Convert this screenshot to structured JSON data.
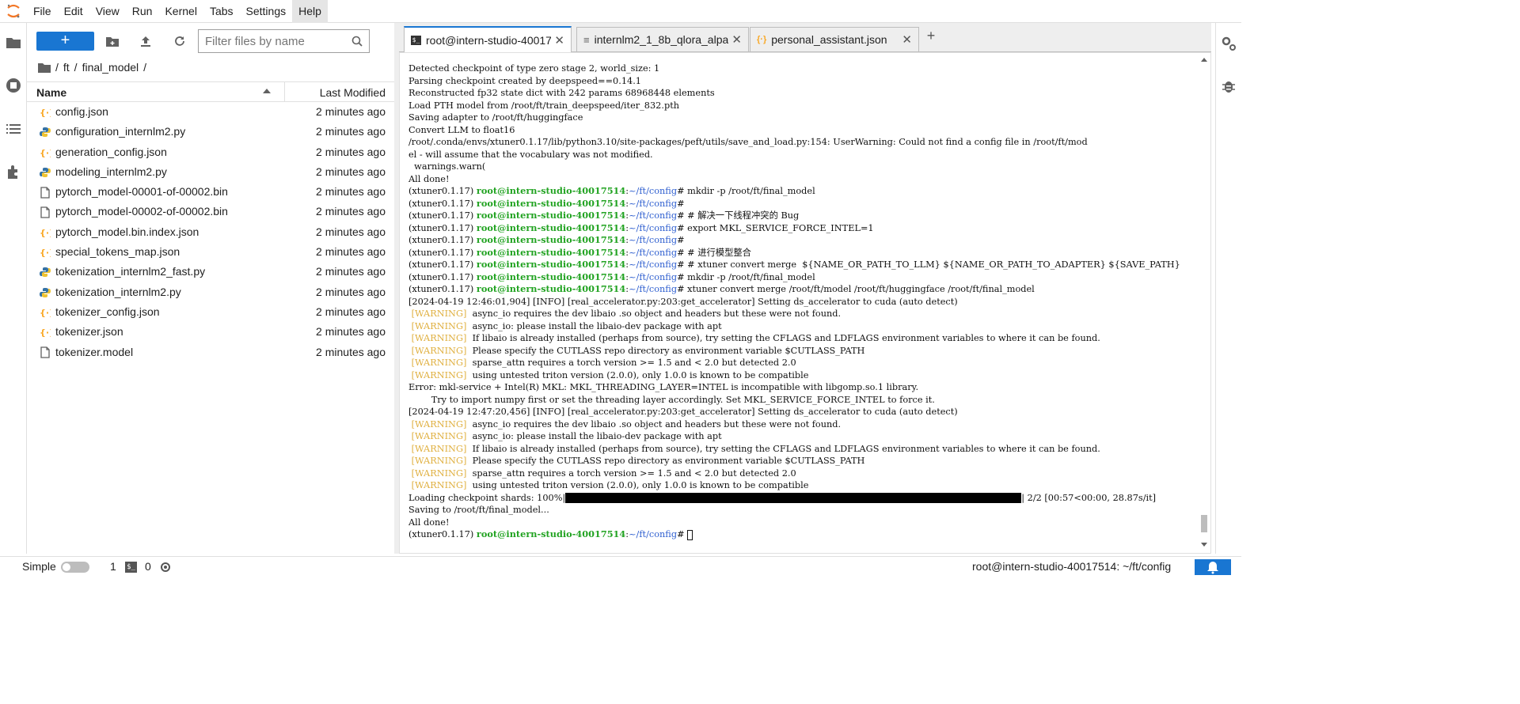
{
  "menu": [
    "File",
    "Edit",
    "View",
    "Run",
    "Kernel",
    "Tabs",
    "Settings",
    "Help"
  ],
  "file_browser": {
    "new_label": "+",
    "filter_placeholder": "Filter files by name",
    "breadcrumb": [
      "/",
      "ft",
      "/",
      "final_model",
      "/"
    ],
    "columns": {
      "name": "Name",
      "modified": "Last Modified"
    },
    "files": [
      {
        "name": "config.json",
        "type": "json",
        "modified": "2 minutes ago"
      },
      {
        "name": "configuration_internlm2.py",
        "type": "py",
        "modified": "2 minutes ago"
      },
      {
        "name": "generation_config.json",
        "type": "json",
        "modified": "2 minutes ago"
      },
      {
        "name": "modeling_internlm2.py",
        "type": "py",
        "modified": "2 minutes ago"
      },
      {
        "name": "pytorch_model-00001-of-00002.bin",
        "type": "file",
        "modified": "2 minutes ago"
      },
      {
        "name": "pytorch_model-00002-of-00002.bin",
        "type": "file",
        "modified": "2 minutes ago"
      },
      {
        "name": "pytorch_model.bin.index.json",
        "type": "json",
        "modified": "2 minutes ago"
      },
      {
        "name": "special_tokens_map.json",
        "type": "json",
        "modified": "2 minutes ago"
      },
      {
        "name": "tokenization_internlm2_fast.py",
        "type": "py",
        "modified": "2 minutes ago"
      },
      {
        "name": "tokenization_internlm2.py",
        "type": "py",
        "modified": "2 minutes ago"
      },
      {
        "name": "tokenizer_config.json",
        "type": "json",
        "modified": "2 minutes ago"
      },
      {
        "name": "tokenizer.json",
        "type": "json",
        "modified": "2 minutes ago"
      },
      {
        "name": "tokenizer.model",
        "type": "file",
        "modified": "2 minutes ago"
      }
    ]
  },
  "tabs": [
    {
      "label": "root@intern-studio-40017",
      "icon": "terminal-icon"
    },
    {
      "label": "internlm2_1_8b_qlora_alpa",
      "icon": "text-file-icon"
    },
    {
      "label": "personal_assistant.json",
      "icon": "json-icon"
    }
  ],
  "terminal": {
    "prompt_env": "(xtuner0.1.17) ",
    "prompt_host": "root@intern-studio-40017514",
    "prompt_path": "~/ft/config",
    "lines": [
      {
        "t": "plain",
        "text": "Detected checkpoint of type zero stage 2, world_size: 1"
      },
      {
        "t": "plain",
        "text": "Parsing checkpoint created by deepspeed==0.14.1"
      },
      {
        "t": "plain",
        "text": "Reconstructed fp32 state dict with 242 params 68968448 elements"
      },
      {
        "t": "plain",
        "text": "Load PTH model from /root/ft/train_deepspeed/iter_832.pth"
      },
      {
        "t": "plain",
        "text": "Saving adapter to /root/ft/huggingface"
      },
      {
        "t": "plain",
        "text": "Convert LLM to float16"
      },
      {
        "t": "plain",
        "text": "/root/.conda/envs/xtuner0.1.17/lib/python3.10/site-packages/peft/utils/save_and_load.py:154: UserWarning: Could not find a config file in /root/ft/mod"
      },
      {
        "t": "plain",
        "text": "el - will assume that the vocabulary was not modified."
      },
      {
        "t": "plain",
        "text": "  warnings.warn("
      },
      {
        "t": "plain",
        "text": "All done!"
      },
      {
        "t": "prompt",
        "text": "mkdir -p /root/ft/final_model"
      },
      {
        "t": "prompt",
        "text": ""
      },
      {
        "t": "prompt",
        "text": "# 解决一下线程冲突的 Bug"
      },
      {
        "t": "prompt",
        "text": "export MKL_SERVICE_FORCE_INTEL=1"
      },
      {
        "t": "prompt",
        "text": ""
      },
      {
        "t": "prompt",
        "text": "# 进行模型整合"
      },
      {
        "t": "prompt",
        "text": "# xtuner convert merge  ${NAME_OR_PATH_TO_LLM} ${NAME_OR_PATH_TO_ADAPTER} ${SAVE_PATH}"
      },
      {
        "t": "prompt",
        "text": "mkdir -p /root/ft/final_model"
      },
      {
        "t": "prompt",
        "text": "xtuner convert merge /root/ft/model /root/ft/huggingface /root/ft/final_model"
      },
      {
        "t": "plain",
        "text": "[2024-04-19 12:46:01,904] [INFO] [real_accelerator.py:203:get_accelerator] Setting ds_accelerator to cuda (auto detect)"
      },
      {
        "t": "warn",
        "text": "async_io requires the dev libaio .so object and headers but these were not found."
      },
      {
        "t": "warn",
        "text": "async_io: please install the libaio-dev package with apt"
      },
      {
        "t": "warn",
        "text": "If libaio is already installed (perhaps from source), try setting the CFLAGS and LDFLAGS environment variables to where it can be found."
      },
      {
        "t": "warn",
        "text": "Please specify the CUTLASS repo directory as environment variable $CUTLASS_PATH"
      },
      {
        "t": "warn",
        "text": "sparse_attn requires a torch version >= 1.5 and < 2.0 but detected 2.0"
      },
      {
        "t": "warn",
        "text": "using untested triton version (2.0.0), only 1.0.0 is known to be compatible"
      },
      {
        "t": "plain",
        "text": "Error: mkl-service + Intel(R) MKL: MKL_THREADING_LAYER=INTEL is incompatible with libgomp.so.1 library."
      },
      {
        "t": "plain",
        "text": "        Try to import numpy first or set the threading layer accordingly. Set MKL_SERVICE_FORCE_INTEL to force it."
      },
      {
        "t": "plain",
        "text": "[2024-04-19 12:47:20,456] [INFO] [real_accelerator.py:203:get_accelerator] Setting ds_accelerator to cuda (auto detect)"
      },
      {
        "t": "warn",
        "text": "async_io requires the dev libaio .so object and headers but these were not found."
      },
      {
        "t": "warn",
        "text": "async_io: please install the libaio-dev package with apt"
      },
      {
        "t": "warn",
        "text": "If libaio is already installed (perhaps from source), try setting the CFLAGS and LDFLAGS environment variables to where it can be found."
      },
      {
        "t": "warn",
        "text": "Please specify the CUTLASS repo directory as environment variable $CUTLASS_PATH"
      },
      {
        "t": "warn",
        "text": "sparse_attn requires a torch version >= 1.5 and < 2.0 but detected 2.0"
      },
      {
        "t": "warn",
        "text": "using untested triton version (2.0.0), only 1.0.0 is known to be compatible"
      },
      {
        "t": "progress",
        "pre": "Loading checkpoint shards: 100%|",
        "post": "| 2/2 [00:57<00:00, 28.87s/it]"
      },
      {
        "t": "plain",
        "text": "Saving to /root/ft/final_model..."
      },
      {
        "t": "plain",
        "text": "All done!"
      },
      {
        "t": "cursor",
        "text": ""
      }
    ],
    "warning_tag": "[WARNING]",
    "progress_fraction": 1.0
  },
  "status": {
    "simple_label": "Simple",
    "kernels": "1",
    "terminals": "0",
    "right_text": "root@intern-studio-40017514: ~/ft/config"
  },
  "colors": {
    "accent": "#1976d2",
    "prompt_host": "#22a322",
    "prompt_path": "#3060d0",
    "warning": "#e0b040"
  }
}
